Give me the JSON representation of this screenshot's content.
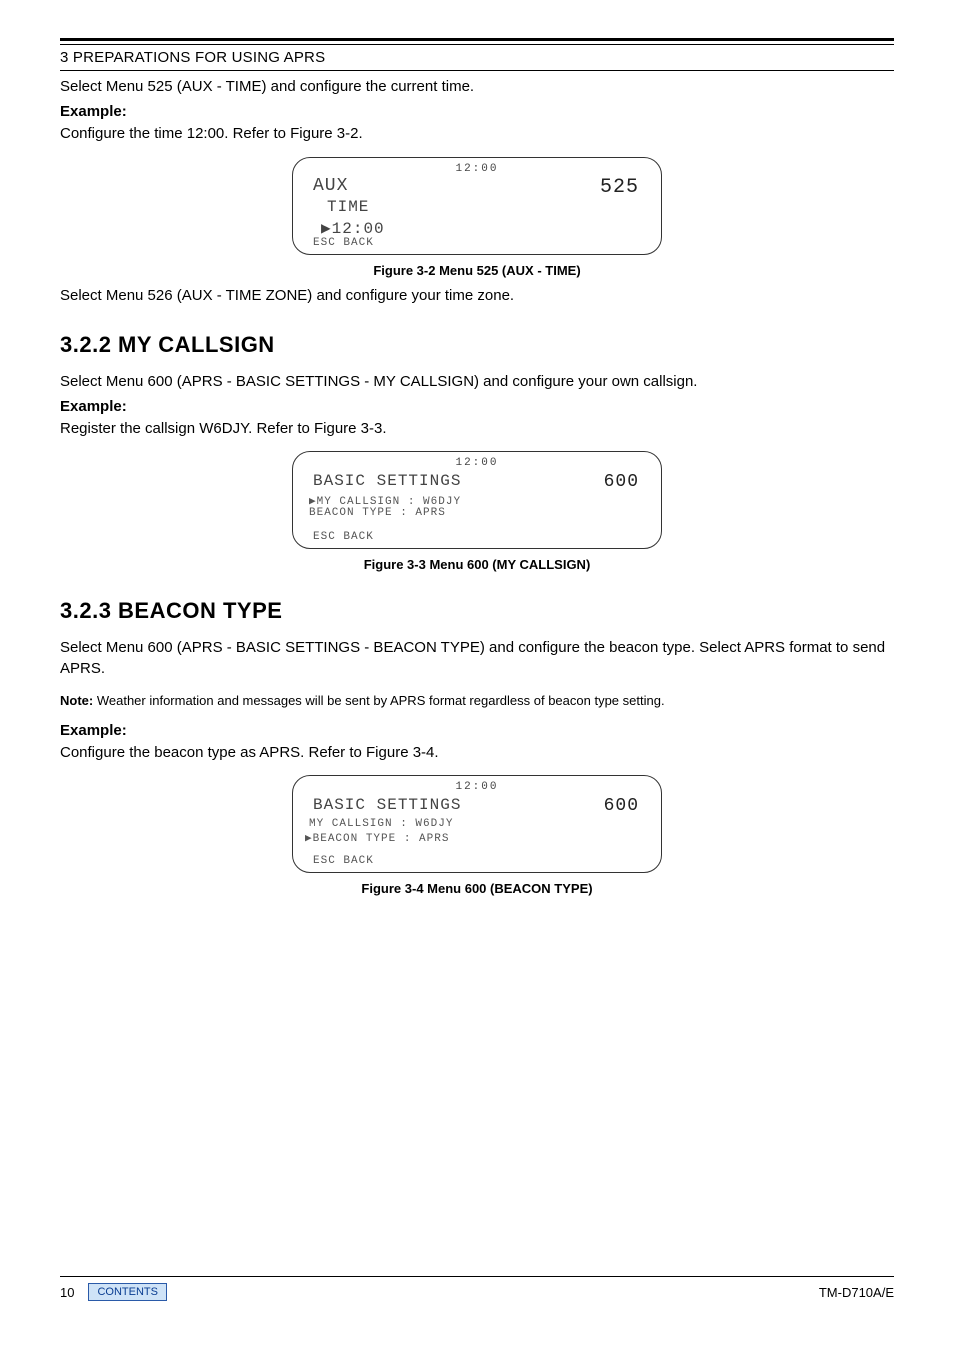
{
  "chapter_title": "3 PREPARATIONS FOR USING APRS",
  "intro_line": "Select Menu 525 (AUX - TIME) and configure the current time.",
  "example_label": "Example:",
  "example_1_text": "Configure the time 12:00.  Refer to Figure 3-2.",
  "lcd1": {
    "clock": "12:00",
    "title": "AUX",
    "menu_no": "525",
    "mid": "TIME",
    "value": "▶12:00",
    "esc": "ESC BACK"
  },
  "fig32_caption": "Figure 3-2   Menu 525 (AUX - TIME)",
  "after_fig32": "Select Menu 526 (AUX - TIME ZONE) and configure your time zone.",
  "section_322": "3.2.2   MY CALLSIGN",
  "s322_body": "Select Menu 600 (APRS - BASIC SETTINGS - MY CALLSIGN) and configure your own callsign.",
  "s322_example_text": "Register the callsign W6DJY.  Refer to Figure 3-3.",
  "lcd2": {
    "clock": "12:00",
    "title": "BASIC SETTINGS",
    "menu_no": "600",
    "line1": "▶MY CALLSIGN : W6DJY",
    "line2": " BEACON TYPE : APRS",
    "esc": "ESC BACK"
  },
  "fig33_caption": "Figure 3-3   Menu 600 (MY CALLSIGN)",
  "section_323": "3.2.3   BEACON TYPE",
  "s323_body1": "Select Menu 600 (APRS - BASIC SETTINGS - BEACON TYPE) and configure the beacon type.  Select APRS format to send APRS.",
  "note_label": "Note:",
  "note_text": "  Weather information and messages will be sent by APRS format regardless of beacon type setting.",
  "s323_example_text": "Configure the beacon type as APRS.  Refer to Figure 3-4.",
  "lcd3": {
    "clock": "12:00",
    "title": "BASIC SETTINGS",
    "menu_no": "600",
    "line1": " MY CALLSIGN : W6DJY",
    "line2": "▶BEACON TYPE : APRS",
    "esc": "ESC BACK"
  },
  "fig34_caption": "Figure 3-4   Menu 600 (BEACON TYPE)",
  "footer": {
    "page_no": "10",
    "contents_label": "CONTENTS",
    "model": "TM-D710A/E"
  }
}
